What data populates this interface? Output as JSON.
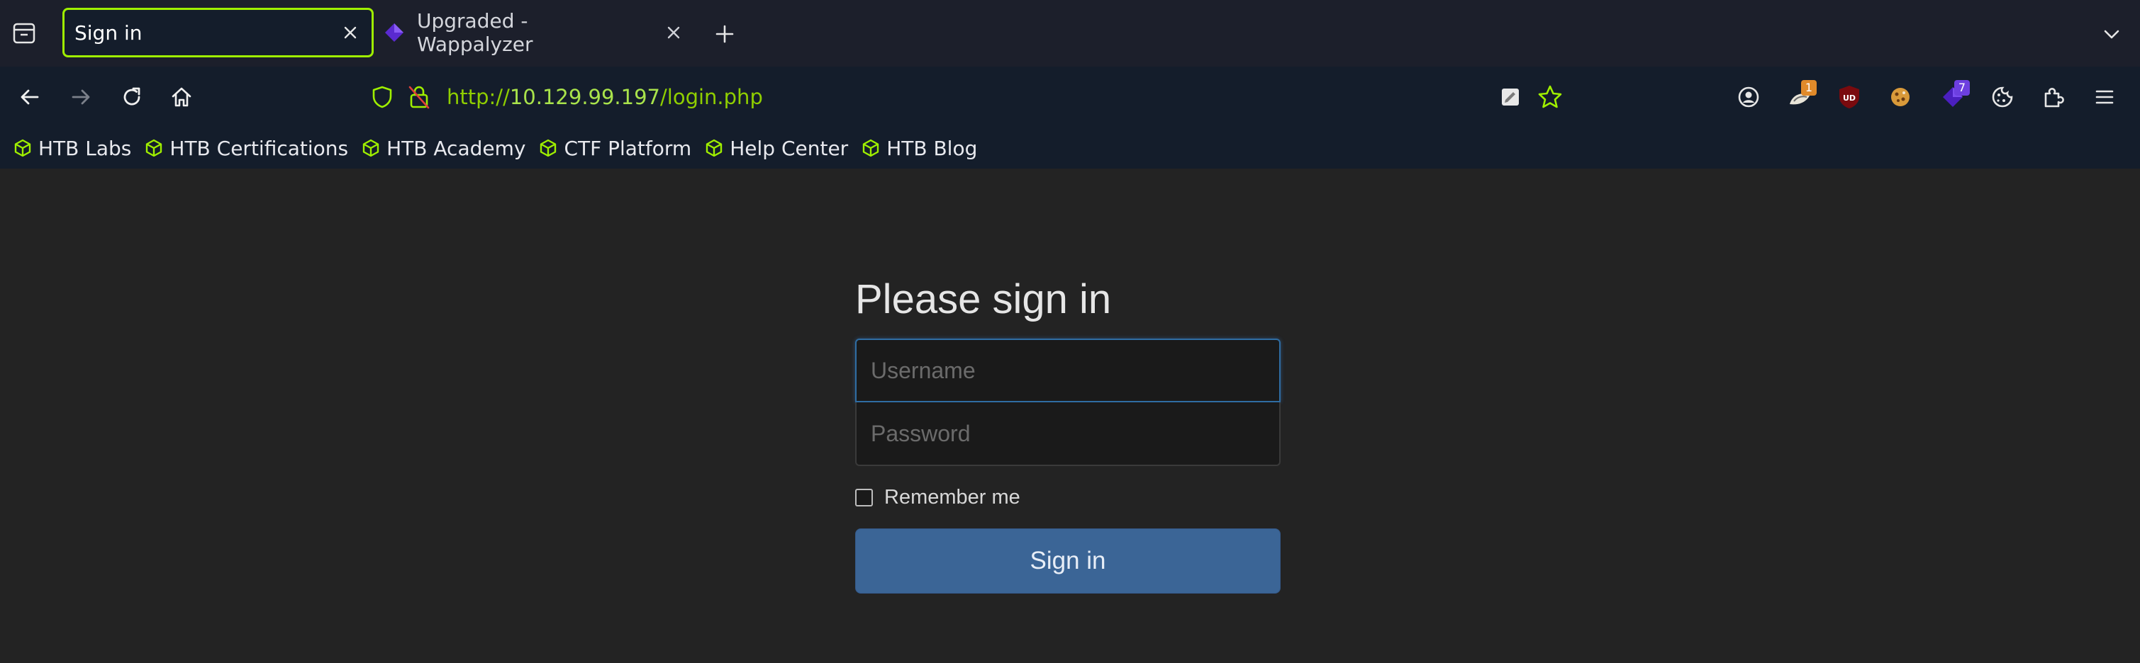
{
  "browser": {
    "tabs": [
      {
        "title": "Sign in",
        "active": true
      },
      {
        "title": "Upgraded - Wappalyzer",
        "active": false
      }
    ],
    "url": {
      "scheme": "http://",
      "host": "10.129.99.197",
      "path": "/login.php"
    },
    "extensions": [
      {
        "name": "notes-extension-icon"
      },
      {
        "name": "bookmark-star-icon"
      },
      {
        "name": "account-icon"
      },
      {
        "name": "foxyproxy-icon",
        "badge": "1"
      },
      {
        "name": "ublock-origin-icon",
        "label": "UD"
      },
      {
        "name": "cookie-editor-icon"
      },
      {
        "name": "wappalyzer-icon",
        "badge": "7"
      },
      {
        "name": "cookie-icon"
      },
      {
        "name": "extensions-icon"
      },
      {
        "name": "menu-icon"
      }
    ],
    "bookmarks": [
      "HTB Labs",
      "HTB Certifications",
      "HTB Academy",
      "CTF Platform",
      "Help Center",
      "HTB Blog"
    ]
  },
  "form": {
    "heading": "Please sign in",
    "username_placeholder": "Username",
    "password_placeholder": "Password",
    "remember_label": "Remember me",
    "submit_label": "Sign in"
  },
  "colors": {
    "accent": "#9fef00",
    "page_background": "#232323",
    "chrome_background": "#141d2b",
    "button": "#3b6596"
  }
}
